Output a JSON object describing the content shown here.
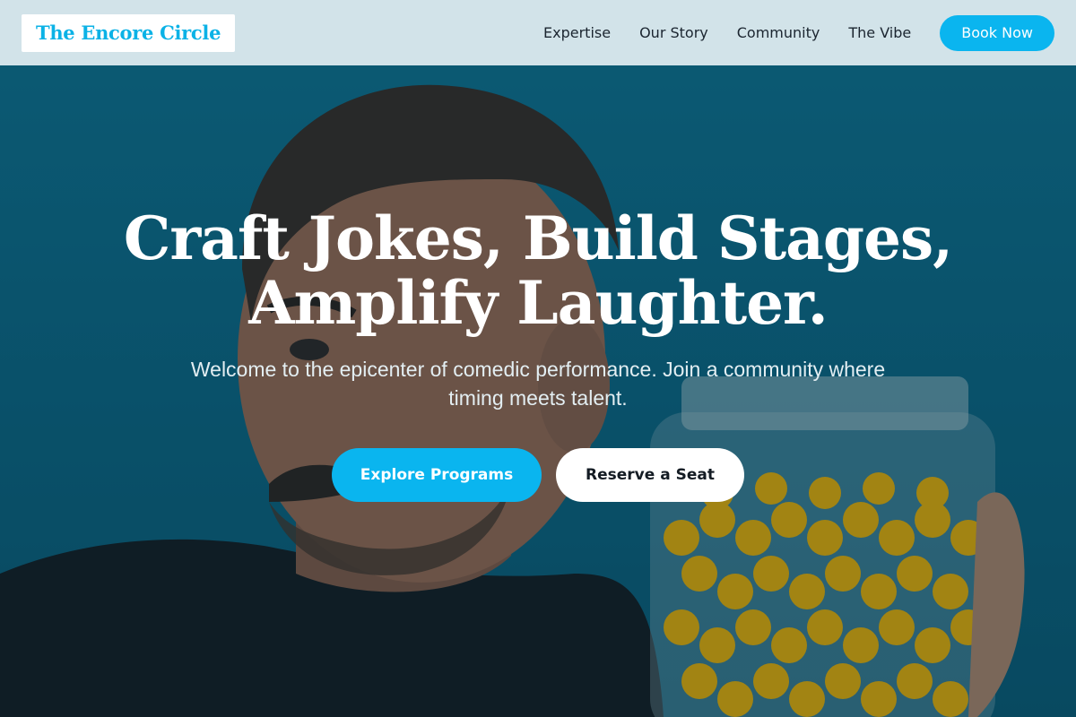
{
  "nav": {
    "logo": "The Encore Circle",
    "links": [
      "Expertise",
      "Our Story",
      "Community",
      "The Vibe"
    ],
    "cta": "Book Now"
  },
  "hero": {
    "headline_line1": "Craft Jokes, Build Stages,",
    "headline_line2": "Amplify Laughter.",
    "subtitle": "Welcome to the epicenter of comedic performance. Join a community where timing meets talent.",
    "primary_button": "Explore Programs",
    "secondary_button": "Reserve a Seat",
    "background_image": "man-with-mustache-holding-candy-jar-photo"
  },
  "colors": {
    "accent": "#0ab5ef",
    "nav_background": "#d2e3e9",
    "hero_background": "#0d6f8f",
    "candy": "#f5b400"
  }
}
